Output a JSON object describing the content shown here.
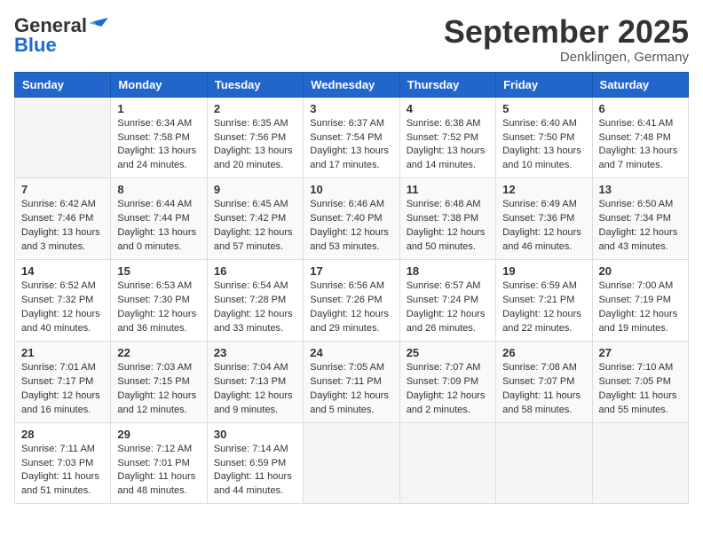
{
  "header": {
    "logo_line1": "General",
    "logo_line2": "Blue",
    "month": "September 2025",
    "location": "Denklingen, Germany"
  },
  "weekdays": [
    "Sunday",
    "Monday",
    "Tuesday",
    "Wednesday",
    "Thursday",
    "Friday",
    "Saturday"
  ],
  "weeks": [
    [
      {
        "day": "",
        "info": ""
      },
      {
        "day": "1",
        "info": "Sunrise: 6:34 AM\nSunset: 7:58 PM\nDaylight: 13 hours and 24 minutes."
      },
      {
        "day": "2",
        "info": "Sunrise: 6:35 AM\nSunset: 7:56 PM\nDaylight: 13 hours and 20 minutes."
      },
      {
        "day": "3",
        "info": "Sunrise: 6:37 AM\nSunset: 7:54 PM\nDaylight: 13 hours and 17 minutes."
      },
      {
        "day": "4",
        "info": "Sunrise: 6:38 AM\nSunset: 7:52 PM\nDaylight: 13 hours and 14 minutes."
      },
      {
        "day": "5",
        "info": "Sunrise: 6:40 AM\nSunset: 7:50 PM\nDaylight: 13 hours and 10 minutes."
      },
      {
        "day": "6",
        "info": "Sunrise: 6:41 AM\nSunset: 7:48 PM\nDaylight: 13 hours and 7 minutes."
      }
    ],
    [
      {
        "day": "7",
        "info": "Sunrise: 6:42 AM\nSunset: 7:46 PM\nDaylight: 13 hours and 3 minutes."
      },
      {
        "day": "8",
        "info": "Sunrise: 6:44 AM\nSunset: 7:44 PM\nDaylight: 13 hours and 0 minutes."
      },
      {
        "day": "9",
        "info": "Sunrise: 6:45 AM\nSunset: 7:42 PM\nDaylight: 12 hours and 57 minutes."
      },
      {
        "day": "10",
        "info": "Sunrise: 6:46 AM\nSunset: 7:40 PM\nDaylight: 12 hours and 53 minutes."
      },
      {
        "day": "11",
        "info": "Sunrise: 6:48 AM\nSunset: 7:38 PM\nDaylight: 12 hours and 50 minutes."
      },
      {
        "day": "12",
        "info": "Sunrise: 6:49 AM\nSunset: 7:36 PM\nDaylight: 12 hours and 46 minutes."
      },
      {
        "day": "13",
        "info": "Sunrise: 6:50 AM\nSunset: 7:34 PM\nDaylight: 12 hours and 43 minutes."
      }
    ],
    [
      {
        "day": "14",
        "info": "Sunrise: 6:52 AM\nSunset: 7:32 PM\nDaylight: 12 hours and 40 minutes."
      },
      {
        "day": "15",
        "info": "Sunrise: 6:53 AM\nSunset: 7:30 PM\nDaylight: 12 hours and 36 minutes."
      },
      {
        "day": "16",
        "info": "Sunrise: 6:54 AM\nSunset: 7:28 PM\nDaylight: 12 hours and 33 minutes."
      },
      {
        "day": "17",
        "info": "Sunrise: 6:56 AM\nSunset: 7:26 PM\nDaylight: 12 hours and 29 minutes."
      },
      {
        "day": "18",
        "info": "Sunrise: 6:57 AM\nSunset: 7:24 PM\nDaylight: 12 hours and 26 minutes."
      },
      {
        "day": "19",
        "info": "Sunrise: 6:59 AM\nSunset: 7:21 PM\nDaylight: 12 hours and 22 minutes."
      },
      {
        "day": "20",
        "info": "Sunrise: 7:00 AM\nSunset: 7:19 PM\nDaylight: 12 hours and 19 minutes."
      }
    ],
    [
      {
        "day": "21",
        "info": "Sunrise: 7:01 AM\nSunset: 7:17 PM\nDaylight: 12 hours and 16 minutes."
      },
      {
        "day": "22",
        "info": "Sunrise: 7:03 AM\nSunset: 7:15 PM\nDaylight: 12 hours and 12 minutes."
      },
      {
        "day": "23",
        "info": "Sunrise: 7:04 AM\nSunset: 7:13 PM\nDaylight: 12 hours and 9 minutes."
      },
      {
        "day": "24",
        "info": "Sunrise: 7:05 AM\nSunset: 7:11 PM\nDaylight: 12 hours and 5 minutes."
      },
      {
        "day": "25",
        "info": "Sunrise: 7:07 AM\nSunset: 7:09 PM\nDaylight: 12 hours and 2 minutes."
      },
      {
        "day": "26",
        "info": "Sunrise: 7:08 AM\nSunset: 7:07 PM\nDaylight: 11 hours and 58 minutes."
      },
      {
        "day": "27",
        "info": "Sunrise: 7:10 AM\nSunset: 7:05 PM\nDaylight: 11 hours and 55 minutes."
      }
    ],
    [
      {
        "day": "28",
        "info": "Sunrise: 7:11 AM\nSunset: 7:03 PM\nDaylight: 11 hours and 51 minutes."
      },
      {
        "day": "29",
        "info": "Sunrise: 7:12 AM\nSunset: 7:01 PM\nDaylight: 11 hours and 48 minutes."
      },
      {
        "day": "30",
        "info": "Sunrise: 7:14 AM\nSunset: 6:59 PM\nDaylight: 11 hours and 44 minutes."
      },
      {
        "day": "",
        "info": ""
      },
      {
        "day": "",
        "info": ""
      },
      {
        "day": "",
        "info": ""
      },
      {
        "day": "",
        "info": ""
      }
    ]
  ]
}
